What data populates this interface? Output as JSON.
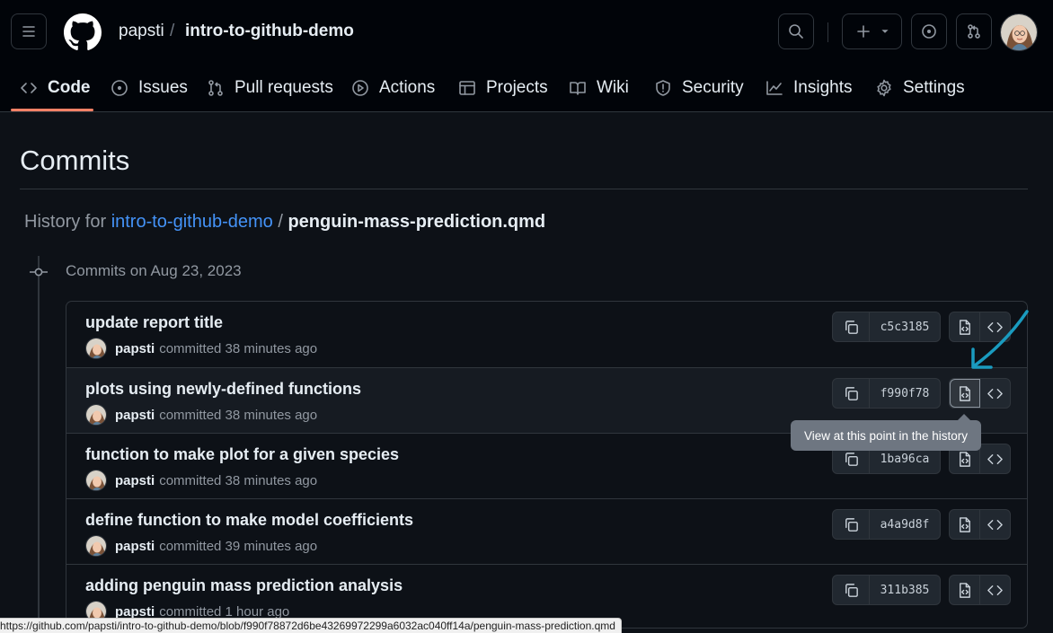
{
  "header": {
    "owner": "papsti",
    "separator": "/",
    "repo": "intro-to-github-demo",
    "icons": [
      "menu-icon",
      "github-logo",
      "search-icon",
      "plus-icon",
      "chevron-down-icon",
      "issues-icon",
      "pull-request-icon",
      "avatar"
    ]
  },
  "nav": {
    "tabs": [
      {
        "label": "Code",
        "icon": "code-icon",
        "active": true
      },
      {
        "label": "Issues",
        "icon": "issue-opened-icon"
      },
      {
        "label": "Pull requests",
        "icon": "git-pull-request-icon"
      },
      {
        "label": "Actions",
        "icon": "play-icon"
      },
      {
        "label": "Projects",
        "icon": "table-icon"
      },
      {
        "label": "Wiki",
        "icon": "book-icon"
      },
      {
        "label": "Security",
        "icon": "shield-icon"
      },
      {
        "label": "Insights",
        "icon": "graph-icon"
      },
      {
        "label": "Settings",
        "icon": "gear-icon"
      }
    ]
  },
  "page": {
    "title": "Commits",
    "history_prefix": "History for",
    "history_repo": "intro-to-github-demo",
    "history_sep": "/",
    "history_file": "penguin-mass-prediction.qmd",
    "day_label": "Commits on Aug 23, 2023"
  },
  "commits": [
    {
      "message": "update report title",
      "author": "papsti",
      "committed": "committed 38 minutes ago",
      "sha": "c5c3185"
    },
    {
      "message": "plots using newly-defined functions",
      "author": "papsti",
      "committed": "committed 38 minutes ago",
      "sha": "f990f78"
    },
    {
      "message": "function to make plot for a given species",
      "author": "papsti",
      "committed": "committed 38 minutes ago",
      "sha": "1ba96ca"
    },
    {
      "message": "define function to make model coefficients",
      "author": "papsti",
      "committed": "committed 39 minutes ago",
      "sha": "a4a9d8f"
    },
    {
      "message": "adding penguin mass prediction analysis",
      "author": "papsti",
      "committed": "committed 1 hour ago",
      "sha": "311b385"
    }
  ],
  "tooltip": "View at this point in the history",
  "status_url": "https://github.com/papsti/intro-to-github-demo/blob/f990f78872d6be43269972299a6032ac040ff14a/penguin-mass-prediction.qmd",
  "colors": {
    "accent": "#4493f8",
    "tab_underline": "#f78166",
    "annotation_arrow": "#1a9bbf",
    "background": "#0d1117"
  }
}
